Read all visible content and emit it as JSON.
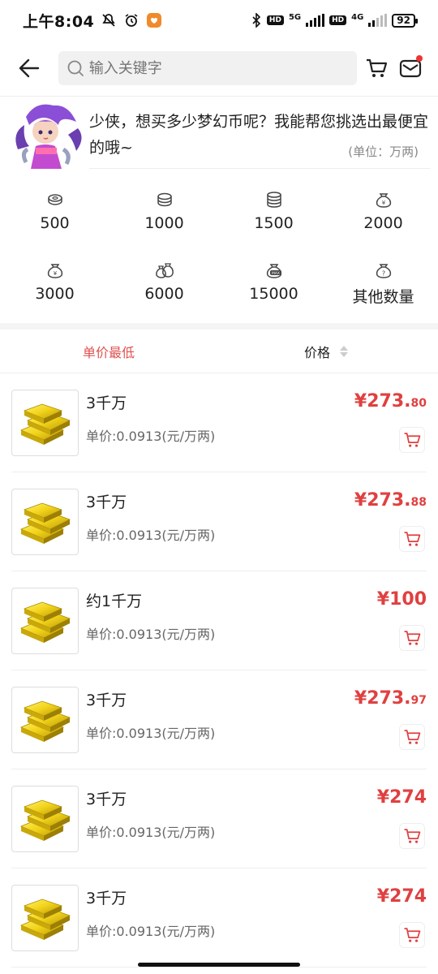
{
  "status": {
    "time": "上午8:04",
    "battery": "92",
    "net5g": "5G",
    "net4g": "4G",
    "hd": "HD"
  },
  "header": {
    "search_placeholder": "输入关键字"
  },
  "banner": {
    "text": "少侠，想买多少梦幻币呢？我能帮您挑选出最便宜的哦~",
    "unit": "(单位：万两)"
  },
  "amounts": [
    "500",
    "1000",
    "1500",
    "2000",
    "3000",
    "6000",
    "15000",
    "其他数量"
  ],
  "sort": {
    "lowest": "单价最低",
    "price": "价格"
  },
  "items": [
    {
      "title": "3千万",
      "unit_price": "单价:0.0913(元/万两)",
      "price_main": "¥273.",
      "price_dec": "80"
    },
    {
      "title": "3千万",
      "unit_price": "单价:0.0913(元/万两)",
      "price_main": "¥273.",
      "price_dec": "88"
    },
    {
      "title": "约1千万",
      "unit_price": "单价:0.0913(元/万两)",
      "price_main": "¥100",
      "price_dec": ""
    },
    {
      "title": "3千万",
      "unit_price": "单价:0.0913(元/万两)",
      "price_main": "¥273.",
      "price_dec": "97"
    },
    {
      "title": "3千万",
      "unit_price": "单价:0.0913(元/万两)",
      "price_main": "¥274",
      "price_dec": ""
    },
    {
      "title": "3千万",
      "unit_price": "单价:0.0913(元/万两)",
      "price_main": "¥274",
      "price_dec": ""
    }
  ],
  "colors": {
    "accent": "#e04040",
    "gold": "#f2d21a"
  }
}
